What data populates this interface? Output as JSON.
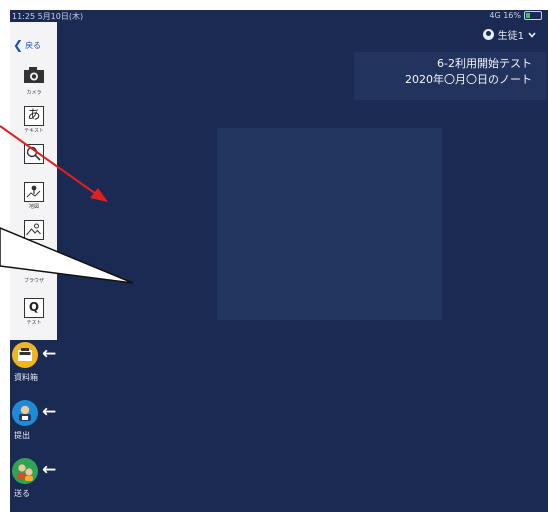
{
  "status": {
    "time": "11:25 5月10日(木)",
    "signal": "4G 16%"
  },
  "header": {
    "user_label": "生徒1",
    "dropdown_icon": "chevron-down-icon"
  },
  "note": {
    "title": "6-2利用開始テスト",
    "subtitle": "2020年〇月〇日のノート"
  },
  "toolbar": {
    "back_label": "戻る",
    "tools": [
      {
        "label": "カメラ",
        "icon": "camera-icon"
      },
      {
        "label": "テキスト",
        "icon": "text-icon",
        "glyph": "あ"
      },
      {
        "label": "",
        "icon": "web-search-icon"
      },
      {
        "label": "地図",
        "icon": "map-icon"
      },
      {
        "label": "",
        "icon": "image-icon"
      },
      {
        "label": "ブラウザ",
        "icon": "browser-icon"
      },
      {
        "label": "テスト",
        "icon": "test-icon",
        "glyph": "Q"
      }
    ]
  },
  "sidebar": {
    "items": [
      {
        "label": "資料箱",
        "icon": "document-box-icon",
        "color": "#f3b51e"
      },
      {
        "label": "提出",
        "icon": "submit-icon",
        "color": "#1f8ad6"
      },
      {
        "label": "送る",
        "icon": "send-icon",
        "color": "#2fa356"
      }
    ]
  },
  "colors": {
    "background": "#1b2a52",
    "annotation": "#e02020"
  }
}
